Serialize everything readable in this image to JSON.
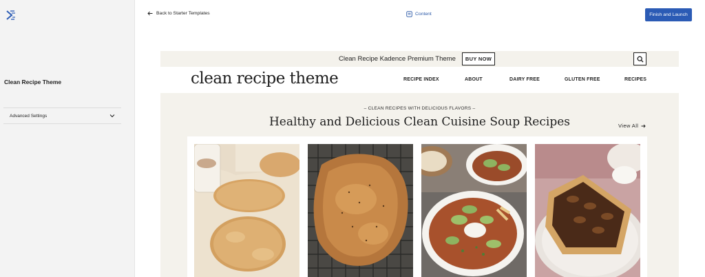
{
  "sidebar": {
    "logo_icon": "kadence-logo-icon",
    "site_title": "Clean Recipe Theme",
    "advanced_settings_label": "Advanced Settings"
  },
  "topbar": {
    "back_label": "Back to Starter Templates",
    "content_label": "Content",
    "finish_label": "Finish and Launch",
    "accent_color": "#2b5bb5"
  },
  "preview": {
    "promo_text": "Clean Recipe Kadence Premium Theme",
    "buy_now_label": "BUY NOW",
    "brand": "clean recipe theme",
    "nav": [
      "RECIPE INDEX",
      "ABOUT",
      "DAIRY FREE",
      "GLUTEN FREE",
      "RECIPES"
    ],
    "kicker": "– CLEAN RECIPES WITH DELICIOUS FLAVORS –",
    "heading": "Healthy and Delicious Clean Cuisine Soup Recipes",
    "view_all": "View All",
    "cards": [
      {
        "image": "flatbread-photo"
      },
      {
        "image": "roast-chicken-photo"
      },
      {
        "image": "tortilla-soup-photo"
      },
      {
        "image": "pecan-pie-photo"
      }
    ],
    "beige": "#f4f2ec"
  }
}
